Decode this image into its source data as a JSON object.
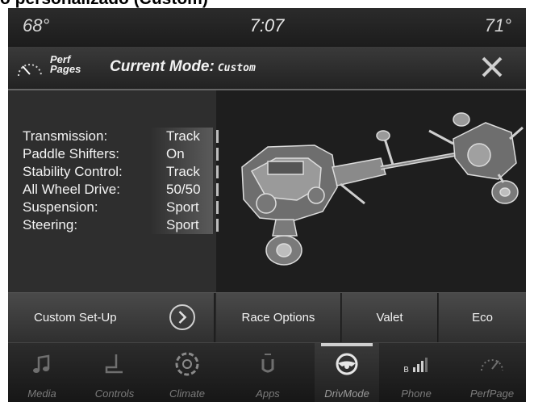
{
  "caption": "o personalizado (Custom)",
  "status": {
    "temp_left": "68°",
    "time": "7:07",
    "temp_right": "71°"
  },
  "header": {
    "perf_label_line1": "Perf",
    "perf_label_line2": "Pages",
    "mode_label": "Current Mode:",
    "mode_value": "Custom"
  },
  "settings": [
    {
      "label": "Transmission:",
      "value": "Track"
    },
    {
      "label": "Paddle Shifters:",
      "value": "On"
    },
    {
      "label": "Stability Control:",
      "value": "Track"
    },
    {
      "label": "All Wheel Drive:",
      "value": "50/50"
    },
    {
      "label": "Suspension:",
      "value": "Sport"
    },
    {
      "label": "Steering:",
      "value": "Sport"
    }
  ],
  "buttons": {
    "custom_setup": "Custom Set-Up",
    "race_options": "Race Options",
    "valet": "Valet",
    "eco": "Eco"
  },
  "nav": [
    "Media",
    "Controls",
    "Climate",
    "Apps",
    "DrivMode",
    "Phone",
    "PerfPage"
  ],
  "active_nav": "DrivMode",
  "colors": {
    "background": "#1a1a1a",
    "text": "#f2f2f2",
    "muted": "#7b7b7b"
  }
}
